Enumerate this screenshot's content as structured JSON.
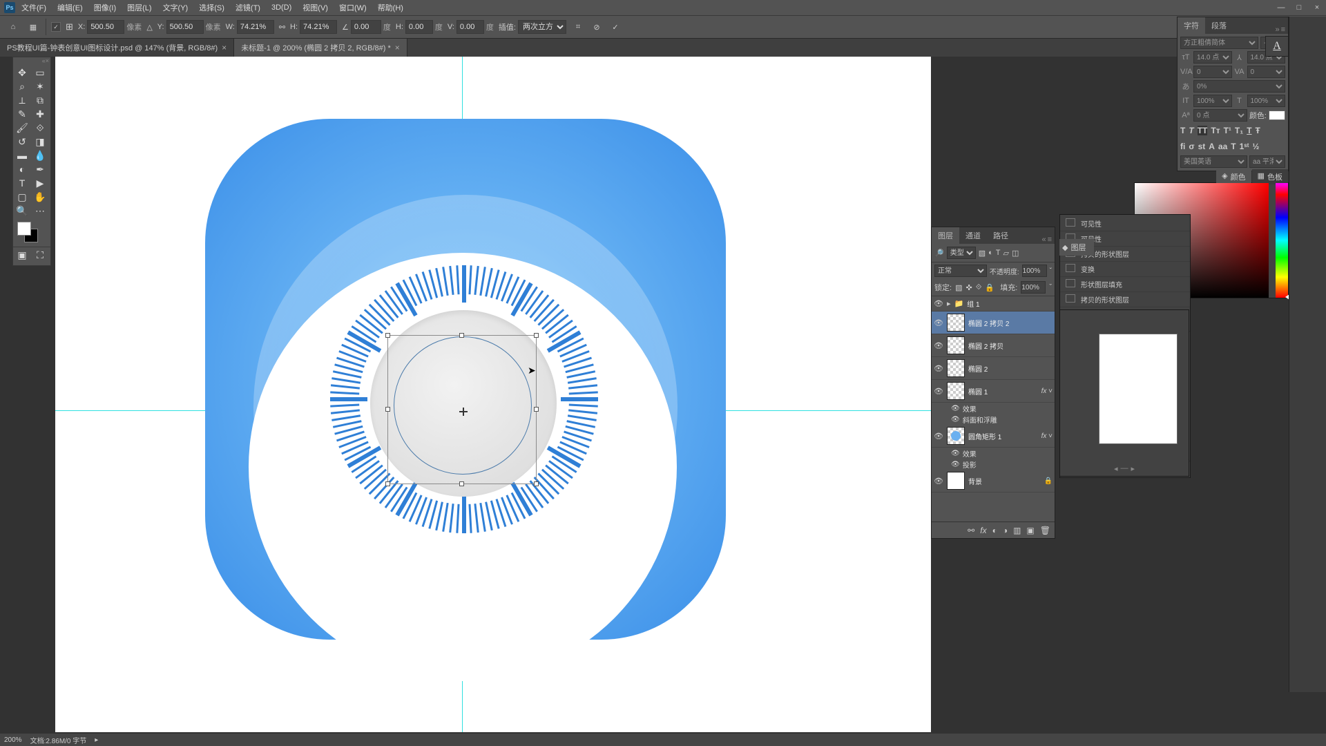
{
  "menubar": {
    "items": [
      "文件(F)",
      "编辑(E)",
      "图像(I)",
      "图层(L)",
      "文字(Y)",
      "选择(S)",
      "滤镜(T)",
      "3D(D)",
      "视图(V)",
      "窗口(W)",
      "帮助(H)"
    ]
  },
  "options": {
    "x_label": "X:",
    "x_value": "500.50",
    "x_unit": "像素",
    "y_label": "Y:",
    "y_value": "500.50",
    "y_unit": "像素",
    "w_label": "W:",
    "w_value": "74.21%",
    "h_label": "H:",
    "h_value": "74.21%",
    "angle_label": "∠",
    "angle_value": "0.00",
    "angle_unit": "度",
    "h_skew_label": "H:",
    "h_skew_value": "0.00",
    "h_skew_unit": "度",
    "v_skew_label": "V:",
    "v_skew_value": "0.00",
    "v_skew_unit": "度",
    "interp_label": "插值:",
    "interp_value": "两次立方"
  },
  "tabs": [
    {
      "label": "PS教程UI篇-钟表创意UI图标设计.psd @ 147% (背景, RGB/8#)",
      "active": false
    },
    {
      "label": "未标题-1 @ 200% (椭圆 2 拷贝 2, RGB/8#) *",
      "active": true
    }
  ],
  "char_panel": {
    "tab1": "字符",
    "tab2": "段落",
    "font": "方正粗倩简体",
    "style": "-",
    "size": "14.0 点",
    "leading": "14.0 点",
    "tracking": "0",
    "kerning": "0%",
    "scale": "100%",
    "baseline": "0 点",
    "vscale": "100%",
    "color_label": "颜色:",
    "lang": "美国英语",
    "aa": "aa 平滑"
  },
  "right_tabs": {
    "color": "颜色",
    "swatch": "色板"
  },
  "layers": {
    "tab1": "图层",
    "tab2": "通道",
    "tab3": "路径",
    "type_label": "类型",
    "blend_mode": "正常",
    "opacity_label": "不透明度:",
    "opacity": "100%",
    "lock_label": "锁定:",
    "fill_label": "填充:",
    "fill": "100%",
    "items": [
      {
        "name": "组 1",
        "kind": "group"
      },
      {
        "name": "椭圆 2 拷贝 2",
        "kind": "shape",
        "selected": true
      },
      {
        "name": "椭圆 2 拷贝",
        "kind": "shape"
      },
      {
        "name": "椭圆 2",
        "kind": "shape"
      },
      {
        "name": "椭圆 1",
        "kind": "shape",
        "fx": true,
        "fx_items": [
          "效果",
          "斜面和浮雕"
        ]
      },
      {
        "name": "圆角矩形 1",
        "kind": "shape",
        "fx": true,
        "thumb": "filled",
        "fx_items": [
          "效果",
          "投影"
        ]
      },
      {
        "name": "背景",
        "kind": "bg",
        "locked": true
      }
    ]
  },
  "history": {
    "items": [
      "可见性",
      "可见性",
      "拷贝的形状图层",
      "变换",
      "形状图层填充",
      "拷贝的形状图层"
    ]
  },
  "second_layers_tab": "图层",
  "collapse_icons_target": "A",
  "status": {
    "zoom": "200%",
    "doc": "文档:2.86M/0 字节"
  }
}
